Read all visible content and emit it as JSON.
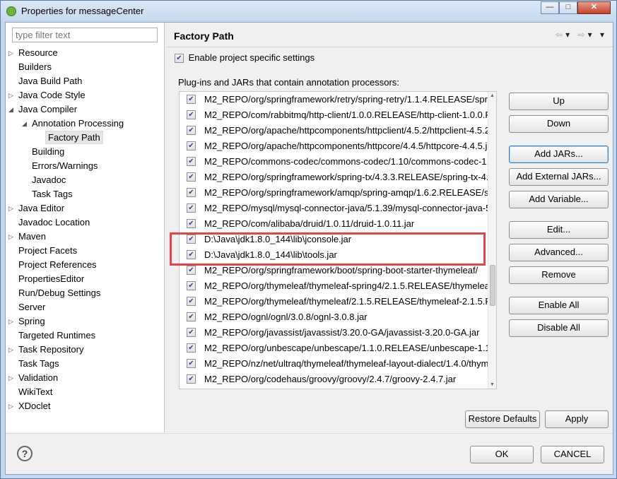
{
  "window": {
    "title": "Properties for messageCenter",
    "buttons": {
      "minimize": "—",
      "maximize": "□",
      "close": "✕"
    }
  },
  "filter": {
    "placeholder": "type filter text"
  },
  "tree": [
    {
      "label": "Resource",
      "expandable": true,
      "level": 0
    },
    {
      "label": "Builders",
      "expandable": false,
      "level": 0
    },
    {
      "label": "Java Build Path",
      "expandable": false,
      "level": 0
    },
    {
      "label": "Java Code Style",
      "expandable": true,
      "level": 0
    },
    {
      "label": "Java Compiler",
      "expandable": true,
      "expanded": true,
      "level": 0
    },
    {
      "label": "Annotation Processing",
      "expandable": true,
      "expanded": true,
      "level": 1
    },
    {
      "label": "Factory Path",
      "expandable": false,
      "level": 2,
      "selected": true
    },
    {
      "label": "Building",
      "expandable": false,
      "level": 1
    },
    {
      "label": "Errors/Warnings",
      "expandable": false,
      "level": 1
    },
    {
      "label": "Javadoc",
      "expandable": false,
      "level": 1
    },
    {
      "label": "Task Tags",
      "expandable": false,
      "level": 1
    },
    {
      "label": "Java Editor",
      "expandable": true,
      "level": 0
    },
    {
      "label": "Javadoc Location",
      "expandable": false,
      "level": 0
    },
    {
      "label": "Maven",
      "expandable": true,
      "level": 0
    },
    {
      "label": "Project Facets",
      "expandable": false,
      "level": 0
    },
    {
      "label": "Project References",
      "expandable": false,
      "level": 0
    },
    {
      "label": "PropertiesEditor",
      "expandable": false,
      "level": 0
    },
    {
      "label": "Run/Debug Settings",
      "expandable": false,
      "level": 0
    },
    {
      "label": "Server",
      "expandable": false,
      "level": 0
    },
    {
      "label": "Spring",
      "expandable": true,
      "level": 0
    },
    {
      "label": "Targeted Runtimes",
      "expandable": false,
      "level": 0
    },
    {
      "label": "Task Repository",
      "expandable": true,
      "level": 0
    },
    {
      "label": "Task Tags",
      "expandable": false,
      "level": 0
    },
    {
      "label": "Validation",
      "expandable": true,
      "level": 0
    },
    {
      "label": "WikiText",
      "expandable": false,
      "level": 0
    },
    {
      "label": "XDoclet",
      "expandable": true,
      "level": 0
    }
  ],
  "page": {
    "title": "Factory Path",
    "nav": {
      "back": "⇦",
      "back_menu": "▾",
      "forward": "⇨",
      "forward_menu": "▾",
      "menu": "▾"
    },
    "enable_label": "Enable project specific settings",
    "enable_checked": true,
    "plugins_label": "Plug-ins and JARs that contain annotation processors:",
    "jars": [
      "M2_REPO/org/springframework/retry/spring-retry/1.1.4.RELEASE/spri",
      "M2_REPO/com/rabbitmq/http-client/1.0.0.RELEASE/http-client-1.0.0.RE",
      "M2_REPO/org/apache/httpcomponents/httpclient/4.5.2/httpclient-4.5.2",
      "M2_REPO/org/apache/httpcomponents/httpcore/4.4.5/httpcore-4.4.5.j",
      "M2_REPO/commons-codec/commons-codec/1.10/commons-codec-1.",
      "M2_REPO/org/springframework/spring-tx/4.3.3.RELEASE/spring-tx-4.3",
      "M2_REPO/org/springframework/amqp/spring-amqp/1.6.2.RELEASE/sp",
      "M2_REPO/mysql/mysql-connector-java/5.1.39/mysql-connector-java-5",
      "M2_REPO/com/alibaba/druid/1.0.11/druid-1.0.11.jar",
      "D:\\Java\\jdk1.8.0_144\\lib\\jconsole.jar",
      "D:\\Java\\jdk1.8.0_144\\lib\\tools.jar",
      "M2_REPO/org/springframework/boot/spring-boot-starter-thymeleaf/",
      "M2_REPO/org/thymeleaf/thymeleaf-spring4/2.1.5.RELEASE/thymeleaf-",
      "M2_REPO/org/thymeleaf/thymeleaf/2.1.5.RELEASE/thymeleaf-2.1.5.REL",
      "M2_REPO/ognl/ognl/3.0.8/ognl-3.0.8.jar",
      "M2_REPO/org/javassist/javassist/3.20.0-GA/javassist-3.20.0-GA.jar",
      "M2_REPO/org/unbescape/unbescape/1.1.0.RELEASE/unbescape-1.1.0.",
      "M2_REPO/nz/net/ultraq/thymeleaf/thymeleaf-layout-dialect/1.4.0/thym",
      "M2_REPO/org/codehaus/groovy/groovy/2.4.7/groovy-2.4.7.jar"
    ],
    "buttons": {
      "up": "Up",
      "down": "Down",
      "add_jars": "Add JARs...",
      "add_external": "Add External JARs...",
      "add_variable": "Add Variable...",
      "edit": "Edit...",
      "advanced": "Advanced...",
      "remove": "Remove",
      "enable_all": "Enable All",
      "disable_all": "Disable All",
      "restore_defaults": "Restore Defaults",
      "apply": "Apply"
    }
  },
  "footer": {
    "help": "?",
    "ok": "OK",
    "cancel": "CANCEL"
  }
}
